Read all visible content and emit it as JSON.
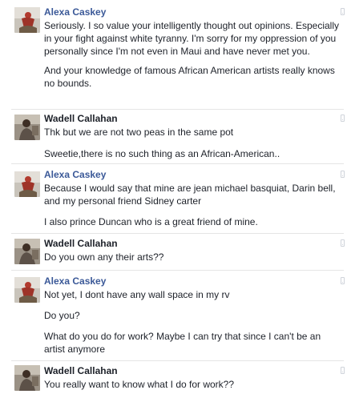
{
  "messages": [
    {
      "sender": "Alexa Caskey",
      "paragraphs": [
        "Seriously. I so value your intelligently thought out opinions. Especially in your fight against white tyranny. I'm sorry for my oppression of you personally since I'm not even in Maui and have never met you.",
        "And your knowledge of famous African American artists really knows no bounds."
      ]
    },
    {
      "sender": "Wadell Callahan",
      "paragraphs": [
        "Thk but we are not two peas in the same pot",
        "Sweetie,there is no such thing as an African-American.."
      ]
    },
    {
      "sender": "Alexa Caskey",
      "paragraphs": [
        "Because I would say that mine are jean michael basquiat, Darin bell, and my personal friend Sidney carter",
        "I also prince Duncan who is a great friend of mine."
      ]
    },
    {
      "sender": "Wadell Callahan",
      "paragraphs": [
        "Do you own any their arts??"
      ]
    },
    {
      "sender": "Alexa Caskey",
      "paragraphs": [
        "Not yet, I dont have any wall space in my rv",
        "Do you?",
        "What do you do for work? Maybe I can try that since  I can't be an artist anymore"
      ]
    },
    {
      "sender": "Wadell Callahan",
      "paragraphs": [
        "You really want to know what I do for work??"
      ]
    }
  ],
  "colors": {
    "alexa_name": "#3b5998",
    "wadell_name": "#1d2129",
    "text": "#1d2129",
    "divider": "#e5e5e5"
  },
  "icons": {
    "message_source": "mobile-phone-icon"
  }
}
